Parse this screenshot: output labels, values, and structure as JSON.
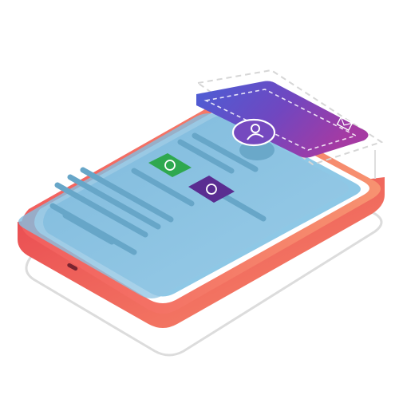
{
  "illustration": {
    "subject": "isometric-smartphone",
    "colors": {
      "phone_body_top": "#f05a5a",
      "phone_body_bottom": "#f58a6b",
      "phone_edge_dark": "#d8444e",
      "screen_frame": "#ffffff",
      "screen_blue": "#8fc9e6",
      "screen_blue_light": "#a9d7ee",
      "content_line": "#6aa8c9",
      "overlay_glass": "#7fb8d8",
      "card_purple_start": "#4f5bd5",
      "card_purple_end": "#a33aa6",
      "whatsapp_green": "#2fa84f",
      "messenger_purple": "#5a2d91",
      "ghost_outline": "#dddddd"
    },
    "icons": [
      "whatsapp-icon",
      "whatsapp-icon",
      "user-profile-icon",
      "mail-icon",
      "usb-port-icon"
    ]
  }
}
